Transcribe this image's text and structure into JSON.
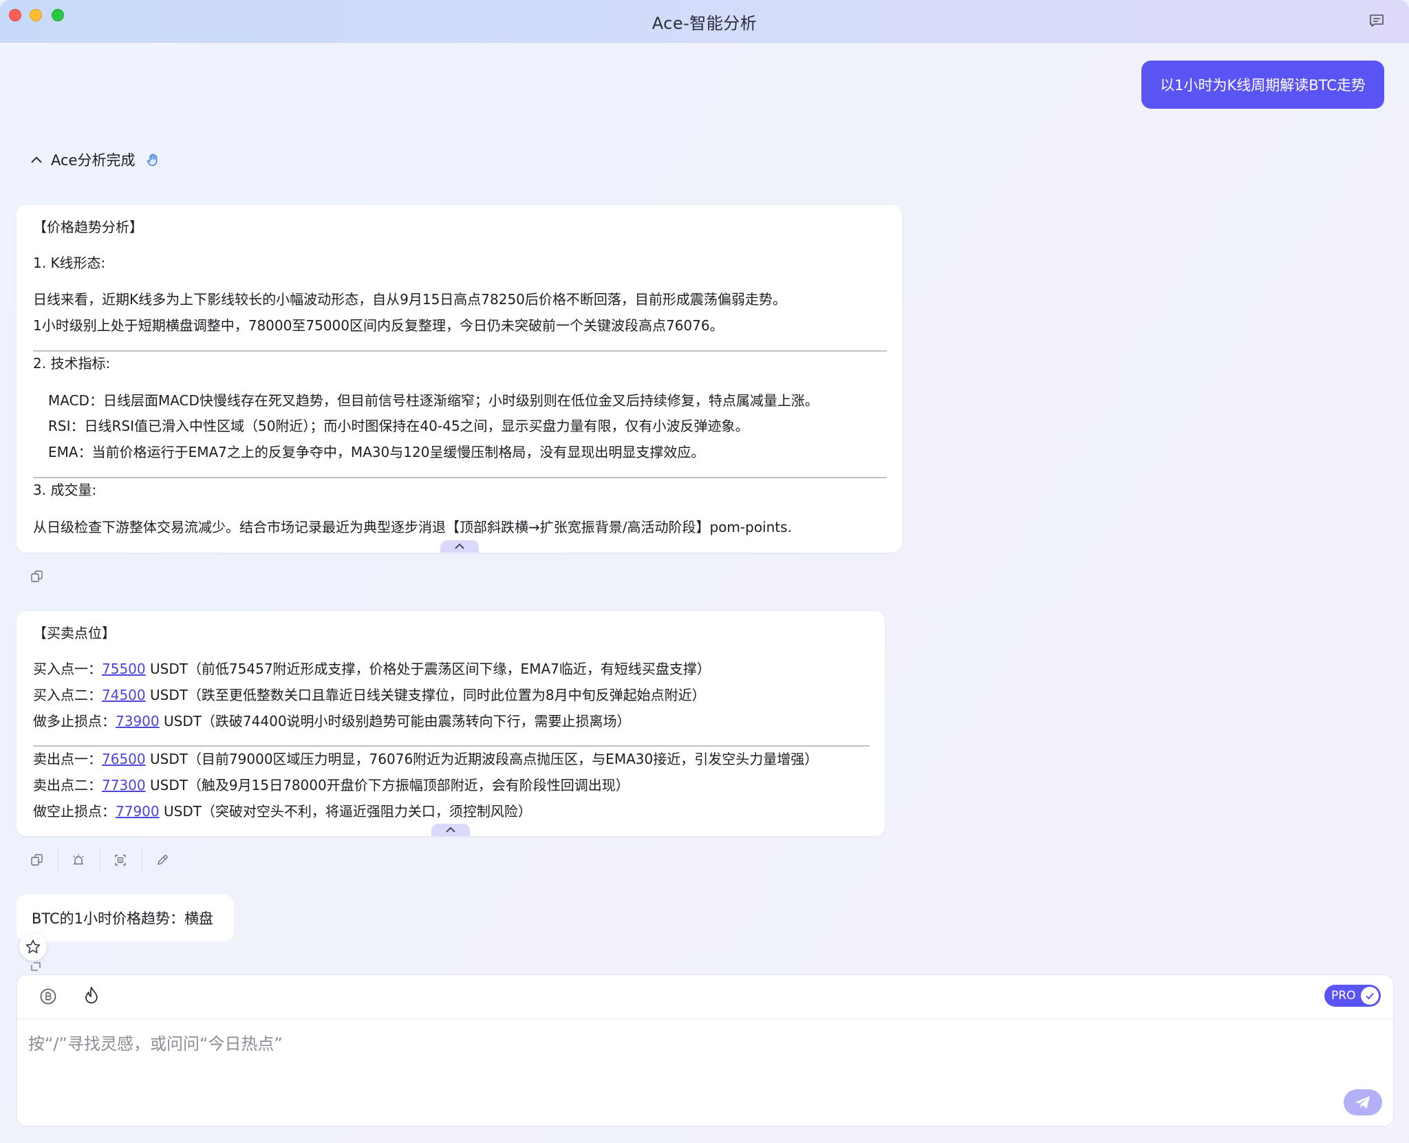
{
  "window": {
    "title": "Ace-智能分析"
  },
  "user_message": "以1小时为K线周期解读BTC走势",
  "status": {
    "label": "Ace分析完成"
  },
  "analysis_card": {
    "title": "【价格趋势分析】",
    "section1_title": "1. K线形态:",
    "section1_lines": [
      "日线来看，近期K线多为上下影线较长的小幅波动形态，自从9月15日高点78250后价格不断回落，目前形成震荡偏弱走势。",
      "1小时级别上处于短期横盘调整中，78000至75000区间内反复整理，今日仍未突破前一个关键波段高点76076。"
    ],
    "section2_title": "2. 技术指标:",
    "section2_lines": [
      "MACD：日线层面MACD快慢线存在死叉趋势，但目前信号柱逐渐缩窄；小时级别则在低位金叉后持续修复，特点属减量上涨。",
      "RSI：日线RSI值已滑入中性区域（50附近）；而小时图保持在40-45之间，显示买盘力量有限，仅有小波反弹迹象。",
      "EMA：当前价格运行于EMA7之上的反复争夺中，MA30与120呈缓慢压制格局，没有显现出明显支撑效应。"
    ],
    "section3_title": "3. 成交量:",
    "section3_lines": [
      "从日级检查下游整体交易流减少。结合市场记录最近为典型逐步消退【顶部斜跌横→扩张宽振背景/高活动阶段】pom-points."
    ]
  },
  "points_card": {
    "title": "【买卖点位】",
    "buy_rows": [
      {
        "label": "买入点一：",
        "price": "75500",
        "text": " USDT（前低75457附近形成支撑，价格处于震荡区间下缘，EMA7临近，有短线买盘支撑）"
      },
      {
        "label": "买入点二：",
        "price": "74500",
        "text": " USDT（跌至更低整数关口且靠近日线关键支撑位，同时此位置为8月中旬反弹起始点附近）"
      },
      {
        "label": "做多止损点：",
        "price": "73900",
        "text": " USDT（跌破74400说明小时级别趋势可能由震荡转向下行，需要止损离场）"
      }
    ],
    "sell_rows": [
      {
        "label": "卖出点一：",
        "price": "76500",
        "text": " USDT（目前79000区域压力明显，76076附近为近期波段高点抛压区，与EMA30接近，引发空头力量增强）"
      },
      {
        "label": "卖出点二：",
        "price": "77300",
        "text": " USDT（触及9月15日78000开盘价下方振幅顶部附近，会有阶段性回调出现）"
      },
      {
        "label": "做空止损点：",
        "price": "77900",
        "text": " USDT（突破对空头不利，将逼近强阻力关口，须控制风险）"
      }
    ]
  },
  "trend_summary": "BTC的1小时价格趋势：横盘",
  "composer": {
    "placeholder": "按“/”寻找灵感，或问问“今日热点”",
    "pro_label": "PRO",
    "pro_enabled": true
  },
  "colors": {
    "accent": "#5b54f5",
    "link": "#4b46d9",
    "send_button": "#b3b0f7"
  },
  "icons": [
    "chat-history-icon",
    "chevron-up-icon",
    "hand-icon",
    "copy-icon",
    "alert-icon",
    "share-icon",
    "edit-icon",
    "star-icon",
    "bitcoin-icon",
    "fire-icon",
    "check-icon",
    "send-icon"
  ]
}
